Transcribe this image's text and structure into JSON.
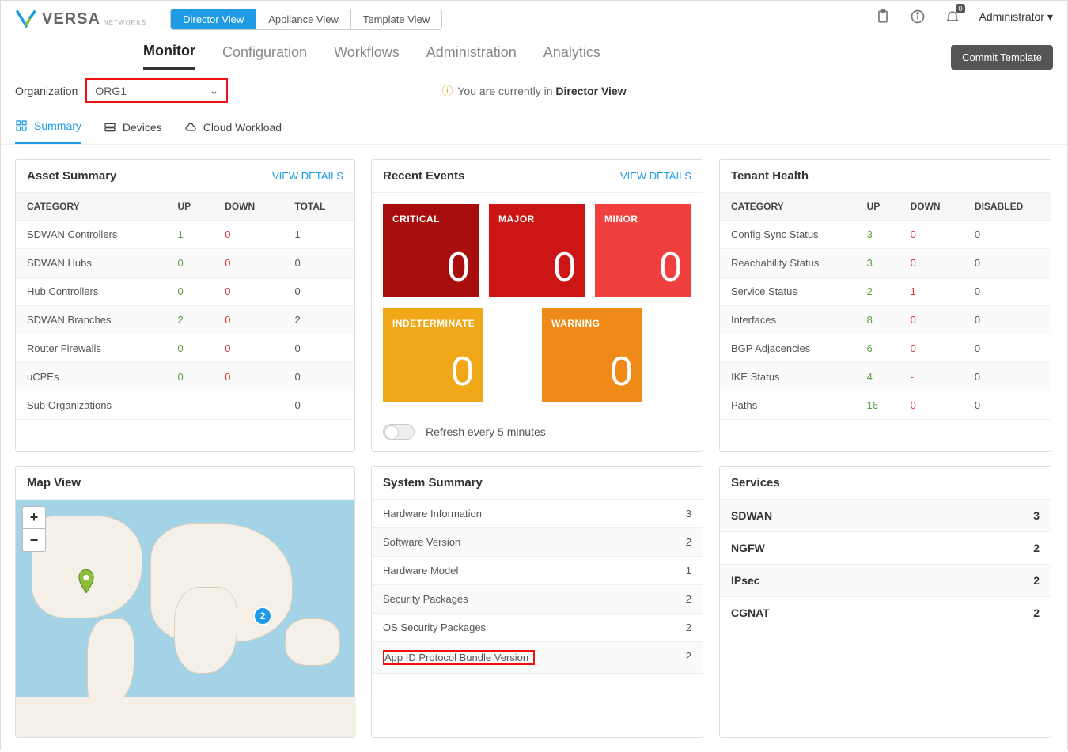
{
  "logo": {
    "text": "VERSA",
    "sub": "NETWORKS"
  },
  "view_tabs": [
    "Director View",
    "Appliance View",
    "Template View"
  ],
  "admin": "Administrator",
  "bell_badge": "0",
  "main_tabs": [
    "Monitor",
    "Configuration",
    "Workflows",
    "Administration",
    "Analytics"
  ],
  "commit": "Commit Template",
  "org_label": "Organization",
  "org_value": "ORG1",
  "dir_notice_pre": "You are currently in ",
  "dir_notice_bold": "Director View",
  "sub_tabs": [
    "Summary",
    "Devices",
    "Cloud Workload"
  ],
  "asset": {
    "title": "Asset Summary",
    "details": "VIEW DETAILS",
    "headers": [
      "CATEGORY",
      "UP",
      "DOWN",
      "TOTAL"
    ],
    "rows": [
      {
        "cat": "SDWAN Controllers",
        "up": "1",
        "down": "0",
        "total": "1"
      },
      {
        "cat": "SDWAN Hubs",
        "up": "0",
        "down": "0",
        "total": "0"
      },
      {
        "cat": "Hub Controllers",
        "up": "0",
        "down": "0",
        "total": "0"
      },
      {
        "cat": "SDWAN Branches",
        "up": "2",
        "down": "0",
        "total": "2"
      },
      {
        "cat": "Router Firewalls",
        "up": "0",
        "down": "0",
        "total": "0"
      },
      {
        "cat": "uCPEs",
        "up": "0",
        "down": "0",
        "total": "0"
      },
      {
        "cat": "Sub Organizations",
        "up": "-",
        "down": "-",
        "total": "0"
      }
    ]
  },
  "events": {
    "title": "Recent Events",
    "details": "VIEW DETAILS",
    "tiles": [
      {
        "label": "CRITICAL",
        "val": "0",
        "cls": "ev-critical"
      },
      {
        "label": "MAJOR",
        "val": "0",
        "cls": "ev-major"
      },
      {
        "label": "MINOR",
        "val": "0",
        "cls": "ev-minor"
      },
      {
        "label": "INDETERMINATE",
        "val": "0",
        "cls": "ev-indet"
      },
      {
        "label": "WARNING",
        "val": "0",
        "cls": "ev-warning"
      }
    ],
    "refresh": "Refresh every 5 minutes"
  },
  "tenant": {
    "title": "Tenant Health",
    "headers": [
      "CATEGORY",
      "UP",
      "DOWN",
      "DISABLED"
    ],
    "rows": [
      {
        "cat": "Config Sync Status",
        "up": "3",
        "down": "0",
        "dis": "0"
      },
      {
        "cat": "Reachability Status",
        "up": "3",
        "down": "0",
        "dis": "0"
      },
      {
        "cat": "Service Status",
        "up": "2",
        "down": "1",
        "dis": "0"
      },
      {
        "cat": "Interfaces",
        "up": "8",
        "down": "0",
        "dis": "0"
      },
      {
        "cat": "BGP Adjacencies",
        "up": "6",
        "down": "0",
        "dis": "0"
      },
      {
        "cat": "IKE Status",
        "up": "4",
        "down": "-",
        "dis": "0"
      },
      {
        "cat": "Paths",
        "up": "16",
        "down": "0",
        "dis": "0"
      }
    ]
  },
  "map": {
    "title": "Map View",
    "zoom_in": "+",
    "zoom_out": "−",
    "marker_count": "2"
  },
  "system": {
    "title": "System Summary",
    "rows": [
      {
        "name": "Hardware Information",
        "val": "3",
        "hl": false
      },
      {
        "name": "Software Version",
        "val": "2",
        "hl": false
      },
      {
        "name": "Hardware Model",
        "val": "1",
        "hl": false
      },
      {
        "name": "Security Packages",
        "val": "2",
        "hl": false
      },
      {
        "name": "OS Security Packages",
        "val": "2",
        "hl": false
      },
      {
        "name": "App ID Protocol Bundle Version",
        "val": "2",
        "hl": true
      }
    ]
  },
  "services": {
    "title": "Services",
    "rows": [
      {
        "name": "SDWAN",
        "val": "3"
      },
      {
        "name": "NGFW",
        "val": "2"
      },
      {
        "name": "IPsec",
        "val": "2"
      },
      {
        "name": "CGNAT",
        "val": "2"
      }
    ]
  }
}
